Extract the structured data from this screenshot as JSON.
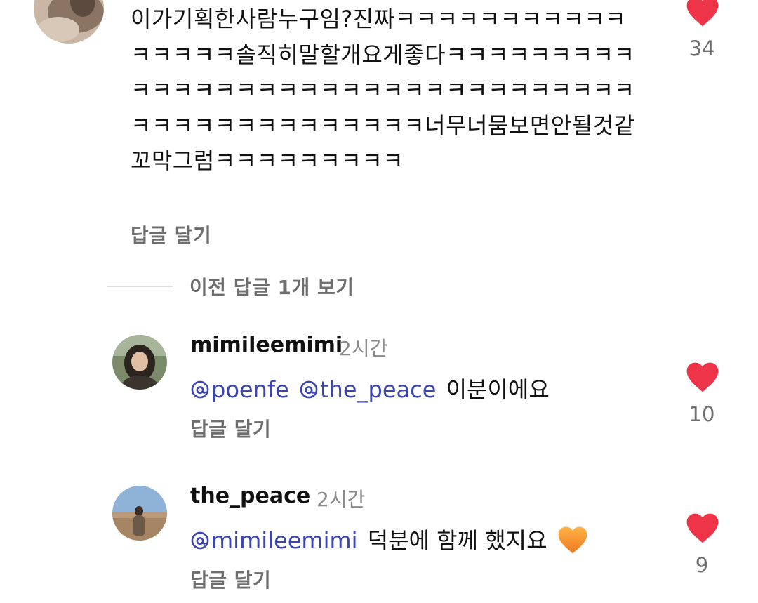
{
  "top_comment": {
    "text": "이가기획한사람누구임?진짜ㅋㅋㅋㅋㅋㅋㅋㅋㅋㅋㅋㅋㅋㅋㅋㅋ솔직히말할개요게좋다ㅋㅋㅋㅋㅋㅋㅋㅋㅋㅋㅋㅋㅋㅋㅋㅋㅋㅋㅋㅋㅋㅋㅋㅋㅋㅋㅋㅋㅋㅋㅋㅋㅋㅋㅋㅋㅋㅋㅋㅋㅋㅋㅋㅋㅋㅋㅋ너무너뭄보면안될것같꼬막그럼ㅋㅋㅋㅋㅋㅋㅋㅋㅋ",
    "reply_label": "답글 달기",
    "likes": "34"
  },
  "view_previous": "이전 답글 1개 보기",
  "replies": [
    {
      "username": "mimileemimi",
      "time": "2시간",
      "mentions": [
        "poenfe",
        "the_peace"
      ],
      "text": "이분이에요",
      "reply_label": "답글 달기",
      "likes": "10"
    },
    {
      "username": "the_peace",
      "time": "2시간",
      "mentions": [
        "mimileemimi"
      ],
      "text": "덕분에 함께 했지요",
      "reply_label": "답글 달기",
      "likes": "9",
      "emoji": "orange-heart-emoji"
    }
  ],
  "colors": {
    "heart": "#ed3449",
    "mention": "#3b45b0",
    "secondary_text": "#6e6e6e"
  }
}
